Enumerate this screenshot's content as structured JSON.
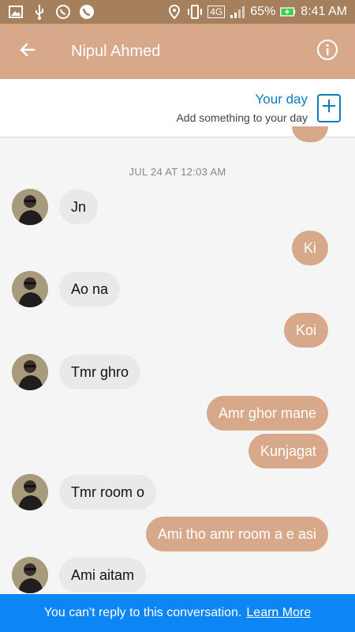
{
  "status_bar": {
    "icons_left": [
      "image-icon",
      "usb-icon",
      "whatsapp-icon",
      "phone-icon"
    ],
    "network": "4G",
    "battery": "65%",
    "time": "8:41 AM"
  },
  "app_bar": {
    "title": "Nipul Ahmed"
  },
  "your_day": {
    "title": "Your day",
    "subtitle": "Add something to your day"
  },
  "chat": {
    "timestamp": "JUL 24 AT 12:03 AM",
    "messages": [
      {
        "dir": "in",
        "text": "Jn"
      },
      {
        "dir": "out",
        "text": "Ki"
      },
      {
        "dir": "in",
        "text": "Ao na"
      },
      {
        "dir": "out",
        "text": "Koi"
      },
      {
        "dir": "in",
        "text": "Tmr ghro"
      },
      {
        "dir": "out",
        "text": "Amr ghor mane"
      },
      {
        "dir": "out",
        "text": "Kunjagat"
      },
      {
        "dir": "in",
        "text": "Tmr room o"
      },
      {
        "dir": "out",
        "text": "Ami tho amr room a e asi"
      },
      {
        "dir": "in",
        "text": "Ami aitam"
      }
    ]
  },
  "footer": {
    "notice": "You can't reply to this conversation.",
    "link": "Learn More"
  },
  "colors": {
    "status_bar": "#a67f5d",
    "accent": "#d7a98a",
    "incoming": "#e9e9e9",
    "link_blue": "#0a7cc4",
    "footer": "#0d86f5"
  }
}
